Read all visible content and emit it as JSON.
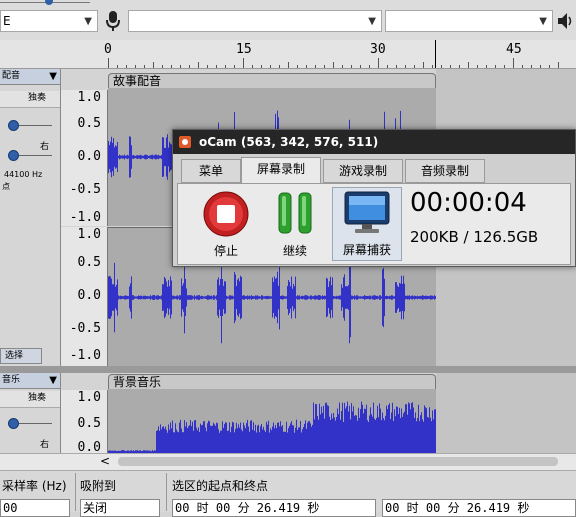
{
  "toolbar": {
    "host_combo": "E",
    "device_combo": "",
    "channels_combo": ""
  },
  "ruler": {
    "ticks": [
      "0",
      "15",
      "30",
      "45"
    ]
  },
  "track1": {
    "name": "配音",
    "solo_label": "独奏",
    "pan_right": "右",
    "rate": "44100 Hz",
    "extra": "点",
    "select_label": "选择",
    "clip_name": "故事配音",
    "scale_top": [
      "1.0",
      "0.5",
      "0.0",
      "-0.5",
      "-1.0"
    ],
    "scale_bottom": [
      "1.0",
      "0.5",
      "0.0",
      "-0.5",
      "-1.0"
    ]
  },
  "track2": {
    "name": "音乐",
    "solo_label": "独奏",
    "pan_right": "右",
    "clip_name": "背景音乐",
    "scale": [
      "1.0",
      "0.5",
      "0.0"
    ]
  },
  "ocam": {
    "title": "oCam (563, 342, 576, 511)",
    "tabs": [
      "菜单",
      "屏幕录制",
      "游戏录制",
      "音频录制"
    ],
    "active_tab": 1,
    "buttons": {
      "stop": "停止",
      "resume": "继续",
      "screenshot": "屏幕捕获"
    },
    "timer": "00:00:04",
    "size": "200KB / 126.5GB"
  },
  "bottom": {
    "rate_label": "采样率 (Hz)",
    "snap_label": "吸附到",
    "selection_label": "选区的起点和终点",
    "rate_value": "00",
    "snap_value": "关闭",
    "start_value": "00 时 00 分 26.419 秒",
    "end_value": "00 时 00 分 26.419 秒"
  },
  "colors": {
    "waveform": "#3232c8",
    "wave_bg": "#ababab",
    "ocam_title": "#262626"
  }
}
